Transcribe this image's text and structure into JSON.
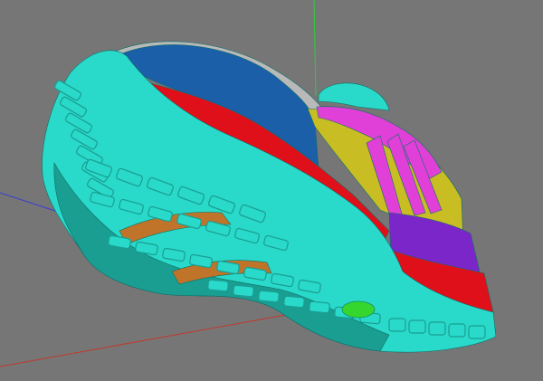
{
  "viewport": {
    "background": "#767676",
    "axis_colors": {
      "x": "#c0392b",
      "y": "#2ecc40",
      "z": "#3b3bd6"
    }
  },
  "model": {
    "subject": "shoe-sole-3d-model",
    "part_colors": {
      "outsole": "#29d9c9",
      "outsole_shadow": "#1a9e92",
      "heel_panel": "#1a5fa8",
      "midsole_stripe": "#e0101a",
      "side_panel": "#c9bd24",
      "lace_panel": "#e040d8",
      "toe_panel": "#7a26c9",
      "insert": "#c0742a",
      "pod": "#35d62e"
    }
  }
}
